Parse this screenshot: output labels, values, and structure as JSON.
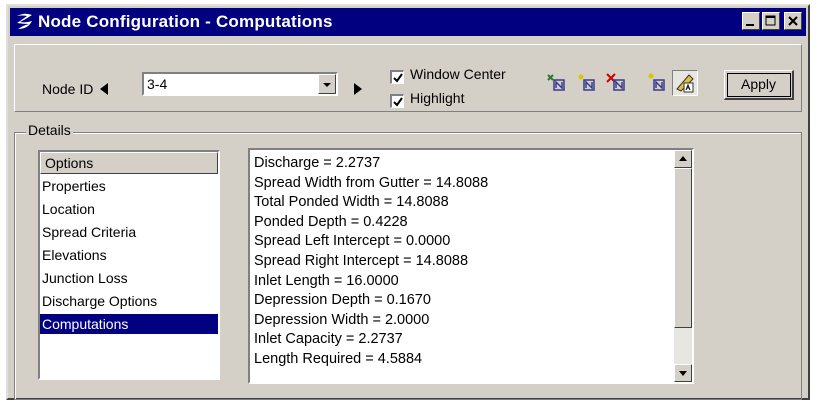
{
  "window": {
    "title": "Node Configuration - Computations",
    "icon": "app-logo-icon",
    "controls": [
      "minimize-icon",
      "maximize-icon",
      "close-icon"
    ]
  },
  "toolbar": {
    "node_id_label": "Node ID",
    "node_id_value": "3-4",
    "prev_icon": "left-arrow-icon",
    "next_icon": "right-arrow-icon",
    "window_center": {
      "label": "Window Center",
      "checked": true
    },
    "highlight": {
      "label": "Highlight",
      "checked": true
    },
    "tools": [
      "add-node-icon",
      "place-node-icon",
      "delete-node-icon",
      "select-node-icon",
      "review-icon"
    ],
    "apply_label": "Apply"
  },
  "details": {
    "legend": "Details",
    "options_header": "Options",
    "options": [
      "Properties",
      "Location",
      "Spread Criteria",
      "Elevations",
      "Junction Loss",
      "Discharge Options",
      "Computations"
    ],
    "selected_option": "Computations",
    "results": [
      "Discharge =   2.2737",
      "Spread Width from Gutter = 14.8088",
      "Total Ponded Width = 14.8088",
      "Ponded Depth =   0.4228",
      "Spread Left Intercept =   0.0000",
      "Spread Right Intercept =   14.8088",
      "Inlet Length = 16.0000",
      "Depression Depth =   0.1670",
      "Depression Width =   2.0000",
      "Inlet Capacity =   2.2737",
      "Length Required =  4.5884"
    ]
  },
  "colors": {
    "titlebar": "#000080",
    "face": "#d4d0c8",
    "selection": "#000080"
  }
}
